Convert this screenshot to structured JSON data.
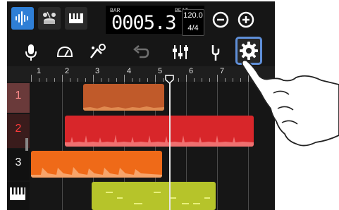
{
  "topbar": {
    "icons": [
      "waveform-icon",
      "drums-icon",
      "keyboard-icon"
    ],
    "bar_label": "BAR",
    "beat_label": "BEAT",
    "counter": "0005.3",
    "tempo": "120.0",
    "time_signature": "4/4",
    "zoom_out": "zoom-out-icon",
    "zoom_in": "zoom-in-icon"
  },
  "tools": [
    "microphone-icon",
    "metronome-icon",
    "fx-icon",
    "undo-icon",
    "mixer-icon",
    "tuning-fork-icon",
    "settings-icon"
  ],
  "ruler": {
    "bar_numbers": [
      "1",
      "2",
      "3",
      "4",
      "5",
      "6",
      "7"
    ]
  },
  "tracks": [
    {
      "label": "1",
      "color": "#c05a2a",
      "region_start_beat": 2.2,
      "region_end_beat": 4.8
    },
    {
      "label": "2",
      "color": "#d8262a",
      "region_start_beat": 1.4,
      "region_end_beat": 7.8
    },
    {
      "label": "3",
      "color": "#ef6a18",
      "region_start_beat": 0.1,
      "region_end_beat": 4.8
    },
    {
      "label": "",
      "icon": "piano-keys-icon",
      "color": "#b6c42a",
      "region_start_beat": 2.8,
      "region_end_beat": 7.0
    }
  ],
  "playhead_position_beat": 5.3,
  "colors": {
    "accent": "#2f7fd6",
    "highlight": "#5f8fd8"
  }
}
